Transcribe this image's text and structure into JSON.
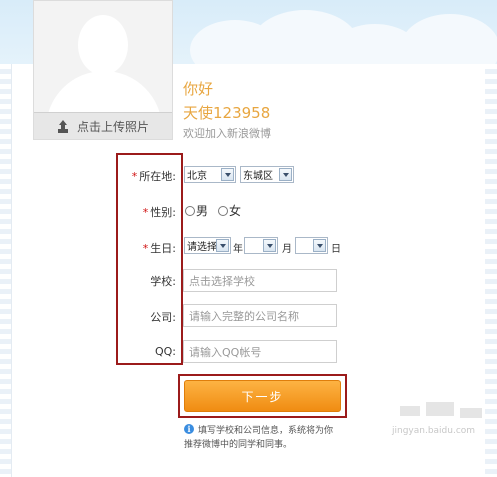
{
  "avatar": {
    "upload_label": "点击上传照片",
    "icon": "upload-icon"
  },
  "greeting": {
    "hello": "你好",
    "username": "天使123958",
    "welcome": "欢迎加入新浪微博"
  },
  "form": {
    "location": {
      "label": "所在地:",
      "required_mark": "*",
      "province": "北京",
      "district": "东城区"
    },
    "gender": {
      "label": "性别:",
      "required_mark": "*",
      "options": [
        "男",
        "女"
      ]
    },
    "birthday": {
      "label": "生日:",
      "required_mark": "*",
      "year_select": "请选择",
      "year_unit": "年",
      "month_select": "",
      "month_unit": "月",
      "day_select": "",
      "day_unit": "日"
    },
    "school": {
      "label": "学校:",
      "placeholder": "点击选择学校"
    },
    "company": {
      "label": "公司:",
      "placeholder": "请输入完整的公司名称"
    },
    "qq": {
      "label": "QQ:",
      "placeholder": "请输入QQ帐号"
    }
  },
  "next_button": {
    "label": "下一步"
  },
  "tip": {
    "icon": "info-icon",
    "line1": "填写学校和公司信息，系统将为你",
    "line2": "推荐微博中的同学和同事。"
  },
  "watermark": "jingyan.baidu.com",
  "colors": {
    "accent_orange": "#f39c1f",
    "highlight_red": "#9b1b1b",
    "greeting_gold": "#e8a640"
  }
}
